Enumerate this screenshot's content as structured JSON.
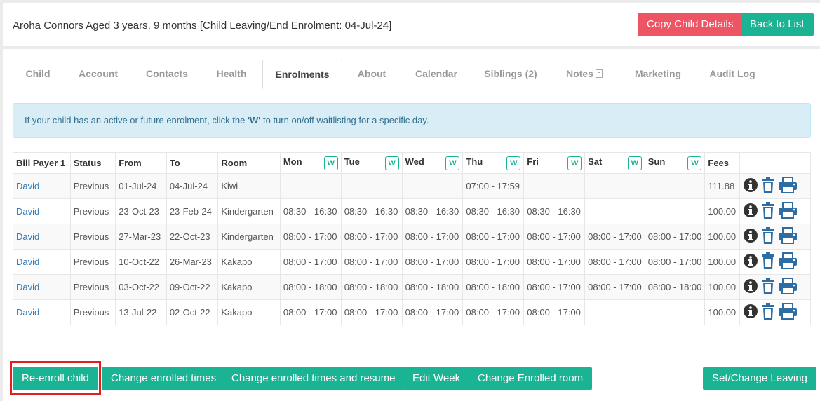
{
  "header": {
    "title": "Aroha Connors Aged 3 years, 9 months [Child Leaving/End Enrolment: 04-Jul-24]",
    "copy_button": "Copy Child Details",
    "back_button": "Back to List"
  },
  "tabs": [
    {
      "label": "Child"
    },
    {
      "label": "Account"
    },
    {
      "label": "Contacts"
    },
    {
      "label": "Health"
    },
    {
      "label": "Enrolments"
    },
    {
      "label": "About"
    },
    {
      "label": "Calendar"
    },
    {
      "label": "Siblings (2)"
    },
    {
      "label": "Notes"
    },
    {
      "label": "Marketing"
    },
    {
      "label": "Audit Log"
    }
  ],
  "active_tab": "Enrolments",
  "info": {
    "before": "If your child has an active or future enrolment, click the ",
    "bold": "'W'",
    "after": " to turn on/off waitlisting for a specific day."
  },
  "table": {
    "headers": [
      "Bill Payer 1",
      "Status",
      "From",
      "To",
      "Room",
      "Mon",
      "Tue",
      "Wed",
      "Thu",
      "Fri",
      "Sat",
      "Sun",
      "Fees",
      ""
    ],
    "waitlist_label": "W",
    "rows": [
      [
        "David",
        "Previous",
        "01-Jul-24",
        "04-Jul-24",
        "Kiwi",
        "",
        "",
        "",
        "07:00 - 17:59",
        "",
        "",
        "",
        "111.88"
      ],
      [
        "David",
        "Previous",
        "23-Oct-23",
        "23-Feb-24",
        "Kindergarten",
        "08:30 - 16:30",
        "08:30 - 16:30",
        "08:30 - 16:30",
        "08:30 - 16:30",
        "08:30 - 16:30",
        "",
        "",
        "100.00"
      ],
      [
        "David",
        "Previous",
        "27-Mar-23",
        "22-Oct-23",
        "Kindergarten",
        "08:00 - 17:00",
        "08:00 - 17:00",
        "08:00 - 17:00",
        "08:00 - 17:00",
        "08:00 - 17:00",
        "08:00 - 17:00",
        "08:00 - 17:00",
        "100.00"
      ],
      [
        "David",
        "Previous",
        "10-Oct-22",
        "26-Mar-23",
        "Kakapo",
        "08:00 - 17:00",
        "08:00 - 17:00",
        "08:00 - 17:00",
        "08:00 - 17:00",
        "08:00 - 17:00",
        "08:00 - 17:00",
        "08:00 - 17:00",
        "100.00"
      ],
      [
        "David",
        "Previous",
        "03-Oct-22",
        "09-Oct-22",
        "Kakapo",
        "08:00 - 18:00",
        "08:00 - 18:00",
        "08:00 - 18:00",
        "08:00 - 18:00",
        "08:00 - 17:00",
        "08:00 - 17:00",
        "08:00 - 18:00",
        "100.00"
      ],
      [
        "David",
        "Previous",
        "13-Jul-22",
        "02-Oct-22",
        "Kakapo",
        "08:00 - 17:00",
        "08:00 - 17:00",
        "08:00 - 17:00",
        "08:00 - 17:00",
        "08:00 - 17:00",
        "",
        "",
        "100.00"
      ]
    ]
  },
  "actions": {
    "reenroll": "Re-enroll child",
    "change_times": "Change enrolled times",
    "change_times_resume": "Change enrolled times and resume",
    "edit_week": "Edit Week",
    "change_room": "Change Enrolled room",
    "set_leaving": "Set/Change Leaving"
  },
  "colors": {
    "red_button": "#ed5565",
    "green_button": "#1ab394",
    "info_bg": "#d9edf7",
    "link": "#337ab7",
    "icon": "#2e6da4",
    "highlight": "#e02020"
  },
  "icons": [
    "info-icon",
    "trash-icon",
    "print-icon",
    "note-icon"
  ]
}
